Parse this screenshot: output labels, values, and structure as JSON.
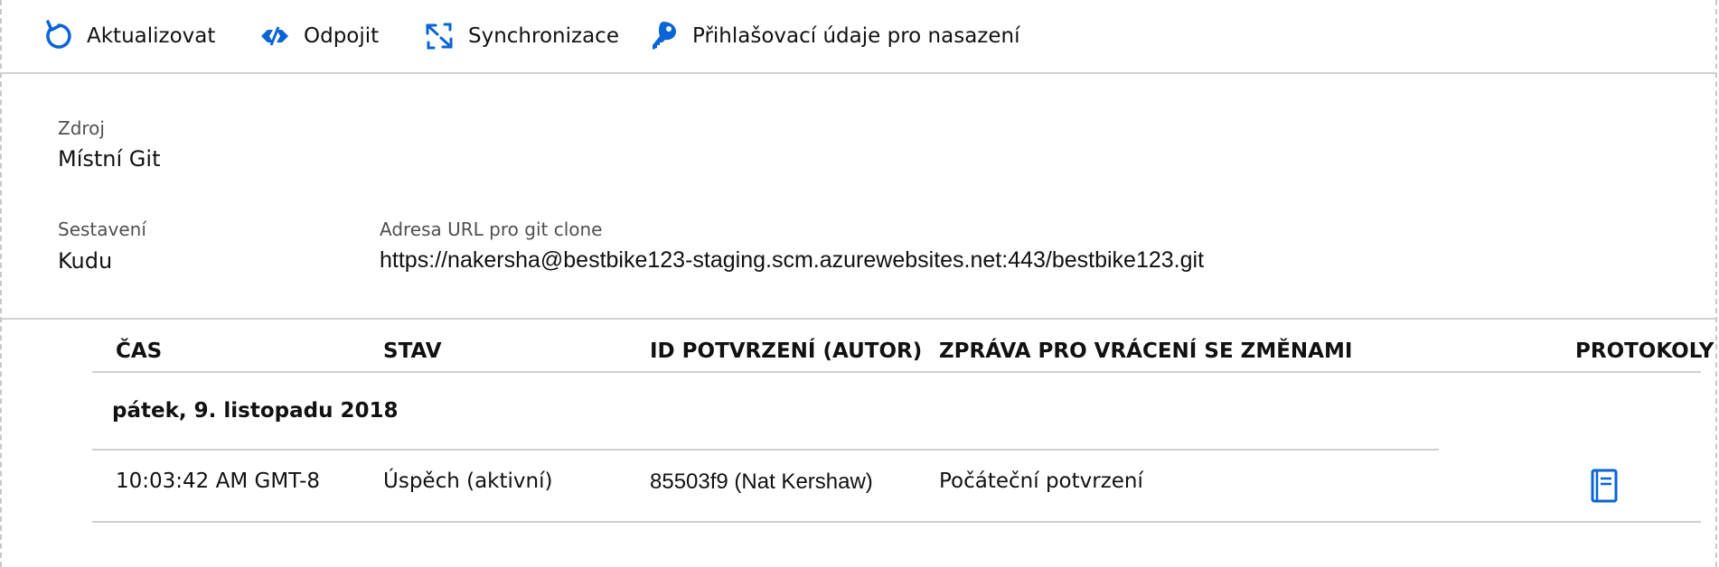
{
  "toolbar": {
    "refresh": {
      "label": "Aktualizovat",
      "icon": "refresh-icon"
    },
    "disconnect": {
      "label": "Odpojit",
      "icon": "disconnect-icon"
    },
    "sync": {
      "label": "Synchronizace",
      "icon": "sync-icon"
    },
    "credentials": {
      "label": "Přihlašovací údaje pro nasazení",
      "icon": "key-icon"
    }
  },
  "source": {
    "label": "Zdroj",
    "value": "Místní Git"
  },
  "build": {
    "label": "Sestavení",
    "value": "Kudu"
  },
  "clone_url": {
    "label": "Adresa URL pro git clone",
    "value": "https://nakersha@bestbike123-staging.scm.azurewebsites.net:443/bestbike123.git"
  },
  "table": {
    "headers": {
      "time": "ČAS",
      "status": "STAV",
      "commit_id": "ID POTVRZENÍ (AUTOR)",
      "message": "ZPRÁVA PRO VRÁCENÍ SE ZMĚNAMI",
      "logs": "PROTOKOLY"
    },
    "group_date": "pátek, 9. listopadu 2018",
    "rows": [
      {
        "time": "10:03:42 AM GMT-8",
        "status": "Úspěch (aktivní)",
        "commit_id": "85503f9 (Nat Kershaw)",
        "message": "Počáteční potvrzení",
        "log_icon": "log-notebook-icon"
      }
    ]
  },
  "colors": {
    "accent": "#0a64d6",
    "divider": "#d0d0d0",
    "label_gray": "#505050"
  }
}
